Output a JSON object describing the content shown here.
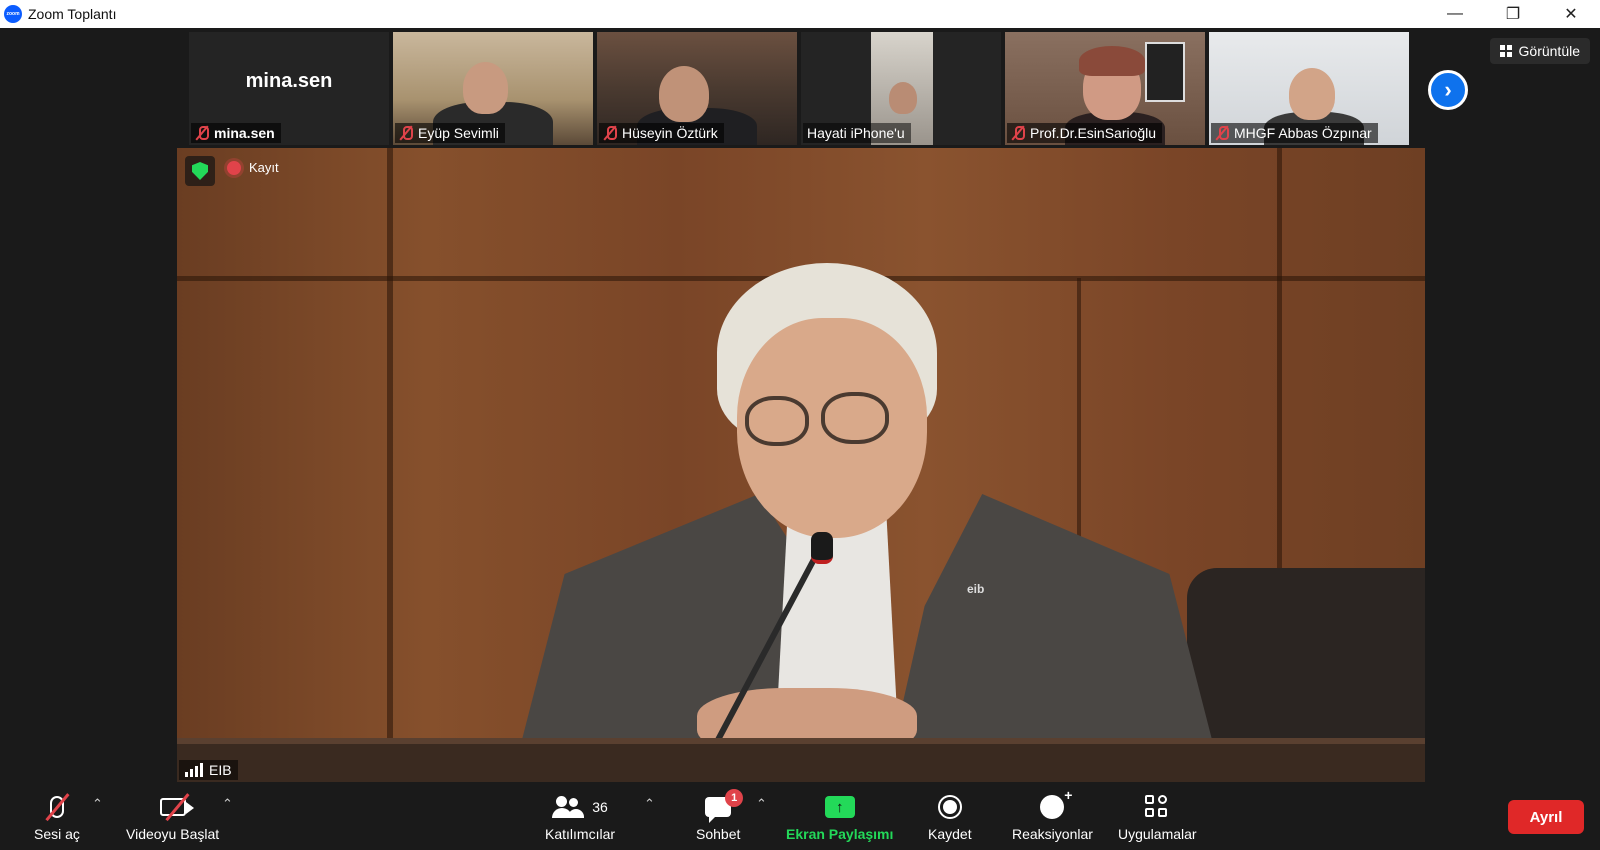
{
  "window": {
    "title": "Zoom Toplantı",
    "app_icon_text": "zoom",
    "controls": [
      "minimize",
      "restore",
      "close"
    ]
  },
  "view_button": {
    "label": "Görüntüle",
    "icon": "grid-icon"
  },
  "participants_strip": [
    {
      "name": "mina.sen",
      "display": "mina.sen",
      "muted": true,
      "video": false
    },
    {
      "name": "Eyüp Sevimli",
      "muted": true,
      "video": true
    },
    {
      "name": "Hüseyin Öztürk",
      "muted": true,
      "video": true
    },
    {
      "name": "Hayati iPhone'u",
      "muted": false,
      "video": true
    },
    {
      "name": "Prof.Dr.EsinSarioğlu",
      "muted": true,
      "video": true
    },
    {
      "name": "MHGF Abbas Özpınar",
      "muted": true,
      "video": true
    }
  ],
  "main_video": {
    "speaker_name": "EIB",
    "recording_label": "Kayıt",
    "badge_text": "eib"
  },
  "toolbar": {
    "audio_label": "Sesi aç",
    "video_label": "Videoyu Başlat",
    "participants_label": "Katılımcılar",
    "participants_count": "36",
    "chat_label": "Sohbet",
    "chat_badge": "1",
    "share_label": "Ekran Paylaşımı",
    "record_label": "Kaydet",
    "reactions_label": "Reaksiyonlar",
    "apps_label": "Uygulamalar",
    "leave_label": "Ayrıl"
  },
  "colors": {
    "accent_blue": "#0e72ed",
    "share_green": "#23d959",
    "leave_red": "#e02828",
    "muted_red": "#e0434a"
  }
}
